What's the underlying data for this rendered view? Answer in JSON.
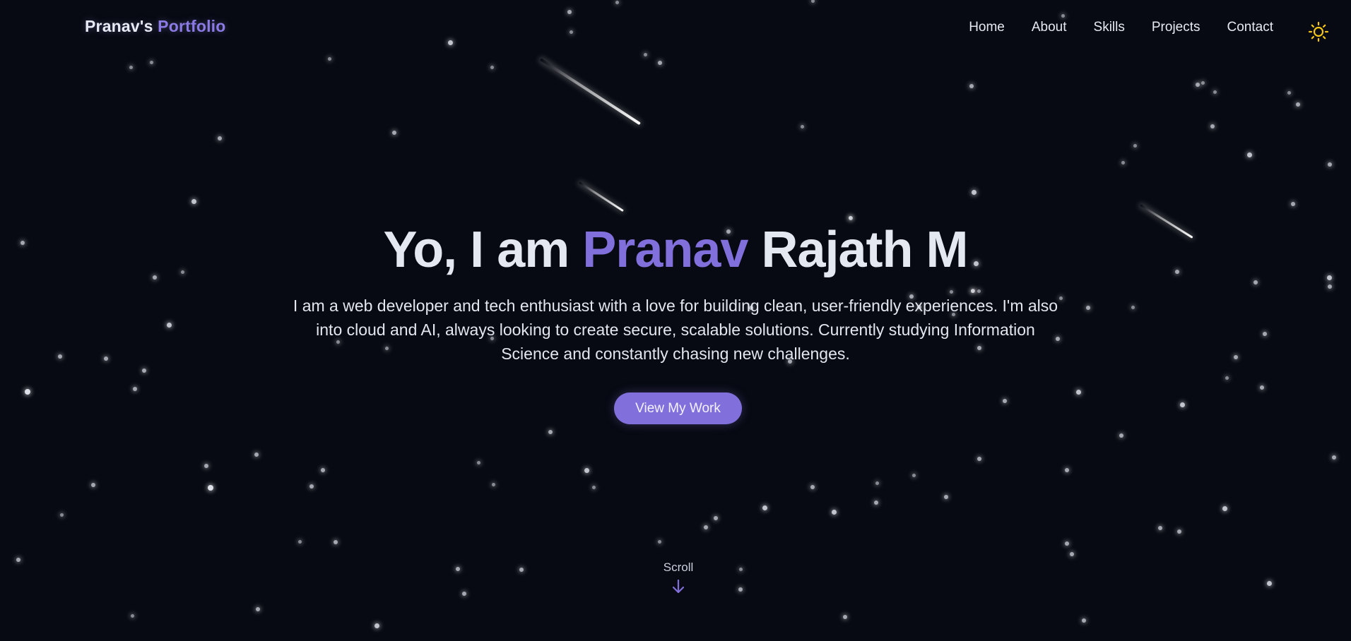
{
  "brand": {
    "name_part": "Pranav's",
    "accent_part": "Portfolio"
  },
  "nav": {
    "items": [
      {
        "label": "Home"
      },
      {
        "label": "About"
      },
      {
        "label": "Skills"
      },
      {
        "label": "Projects"
      },
      {
        "label": "Contact"
      }
    ],
    "theme_toggle_icon": "sun-icon"
  },
  "hero": {
    "title_prefix": "Yo, I am",
    "title_accent": "Pranav",
    "title_suffix": "Rajath M",
    "description": "I am a web developer and tech enthusiast with a love for building clean, user-friendly experiences. I'm also into cloud and AI, always looking to create secure, scalable solutions. Currently studying Information Science and constantly chasing new challenges.",
    "cta_label": "View My Work"
  },
  "scroll_indicator": {
    "label": "Scroll",
    "icon": "arrow-down-icon"
  },
  "colors": {
    "background": "#070a12",
    "accent": "#8170dc",
    "text": "#e4e8f1",
    "sun": "#f5c518"
  }
}
